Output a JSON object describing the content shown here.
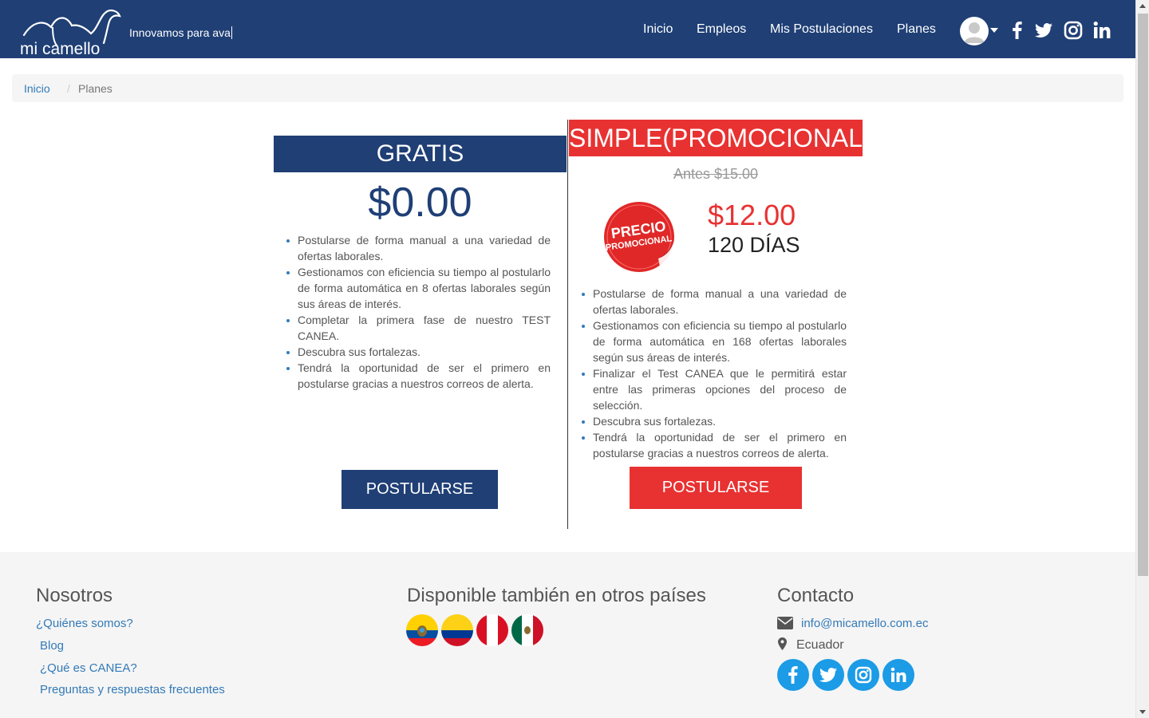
{
  "header": {
    "logo_text": "mi camello",
    "tagline": "Innovamos para ava",
    "nav": [
      "Inicio",
      "Empleos",
      "Mis Postulaciones",
      "Planes"
    ],
    "social": [
      "facebook-icon",
      "twitter-icon",
      "instagram-icon",
      "linkedin-icon"
    ],
    "bg_color": "#1f3f75"
  },
  "breadcrumb": {
    "home": "Inicio",
    "separator": "/",
    "current": "Planes"
  },
  "plans": {
    "free": {
      "title": "GRATIS",
      "price": "$0.00",
      "features": [
        "Postularse de forma manual a una variedad de ofertas laborales.",
        "Gestionamos con eficiencia su tiempo al postularlo de forma automática en 8 ofertas laborales según sus áreas de interés.",
        "Completar la primera fase de nuestro TEST CANEA.",
        "Descubra sus fortalezas.",
        "Tendrá la oportunidad de ser el primero en postularse gracias a nuestros correos de alerta."
      ],
      "button": "POSTULARSE",
      "color": "#1f3f75"
    },
    "simple": {
      "title": "SIMPLE(PROMOCIONAL)",
      "old_price": "Antes $15.00",
      "badge_line1": "PRECIO",
      "badge_line2": "PROMOCIONAL",
      "price": "$12.00",
      "duration": "120 DÍAS",
      "features": [
        "Postularse de forma manual a una variedad de ofertas laborales.",
        "Gestionamos con eficiencia su tiempo al postularlo de forma automática en 168 ofertas laborales según sus áreas de interés.",
        "Finalizar el Test CANEA que le permitirá estar entre las primeras opciones del proceso de selección.",
        "Descubra sus fortalezas.",
        "Tendrá la oportunidad de ser el primero en postularse gracias a nuestros correos de alerta."
      ],
      "button": "POSTULARSE",
      "color": "#e83232"
    }
  },
  "footer": {
    "about": {
      "heading": "Nosotros",
      "links": [
        "¿Quiénes somos?",
        "Blog",
        "¿Qué es CANEA?",
        "Preguntas y respuestas frecuentes"
      ]
    },
    "countries": {
      "heading": "Disponible también en otros países",
      "flags": [
        "ecuador-flag",
        "colombia-flag",
        "peru-flag",
        "mexico-flag"
      ]
    },
    "contact": {
      "heading": "Contacto",
      "email": "info@micamello.com.ec",
      "location": "Ecuador",
      "social": [
        "facebook-icon",
        "twitter-icon",
        "instagram-icon",
        "linkedin-icon"
      ]
    }
  }
}
